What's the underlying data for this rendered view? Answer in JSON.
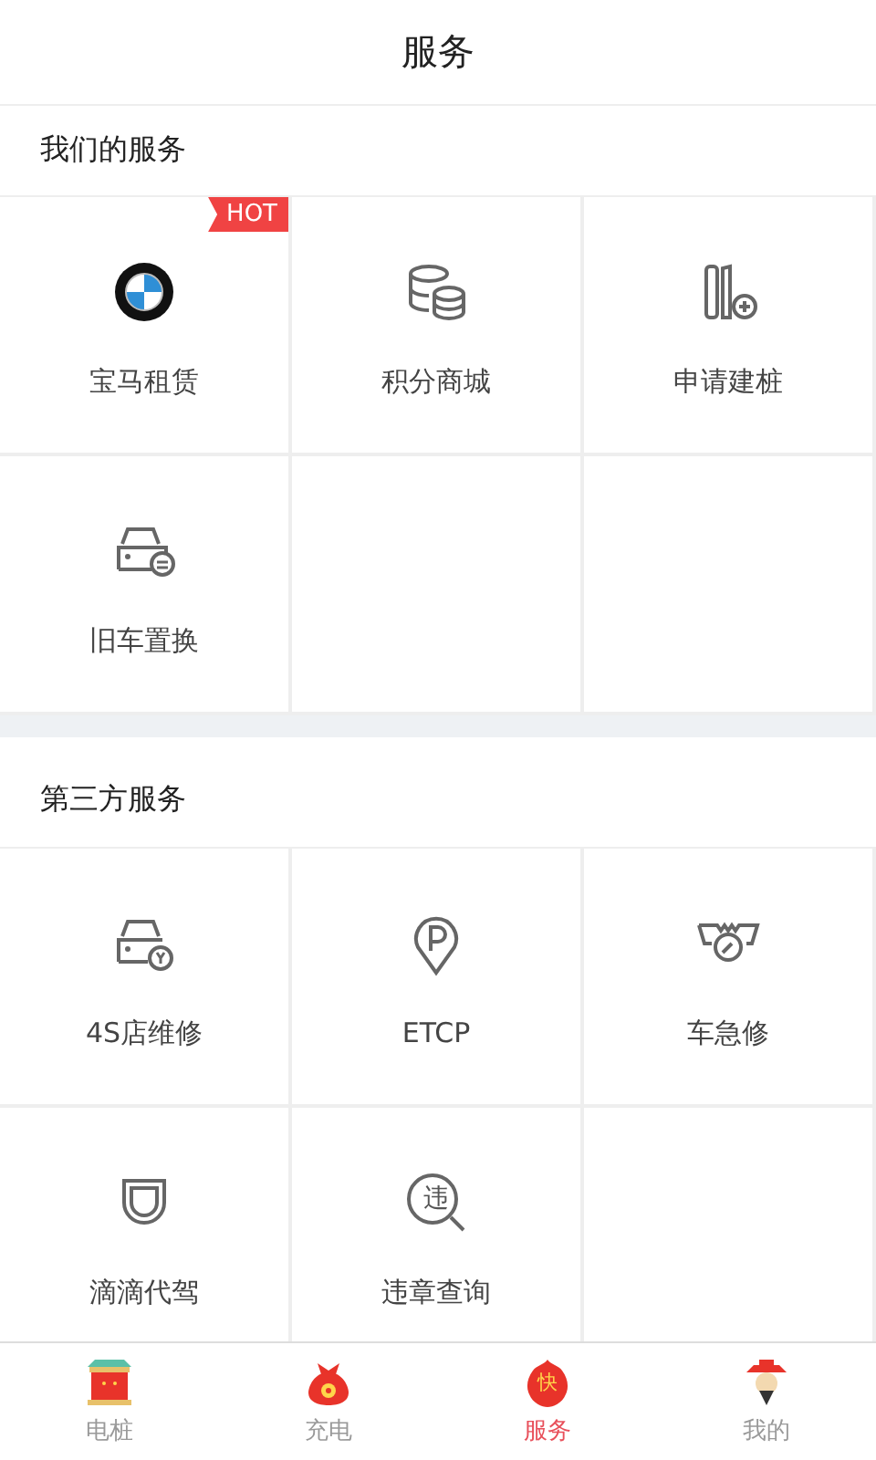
{
  "header": {
    "title": "服务"
  },
  "sections": [
    {
      "title": "我们的服务",
      "items": [
        {
          "label": "宝马租赁",
          "kind": "bmw",
          "badge": "HOT"
        },
        {
          "label": "积分商城",
          "kind": "coins"
        },
        {
          "label": "申请建桩",
          "kind": "pile"
        },
        {
          "label": "旧车置换",
          "kind": "car-swap"
        }
      ]
    },
    {
      "title": "第三方服务",
      "items": [
        {
          "label": "4S店维修",
          "kind": "car-repair"
        },
        {
          "label": "ETCP",
          "kind": "parking"
        },
        {
          "label": "车急修",
          "kind": "tow"
        },
        {
          "label": "滴滴代驾",
          "kind": "didi"
        },
        {
          "label": "违章查询",
          "kind": "violation",
          "icon_char": "违"
        }
      ]
    }
  ],
  "tabs": [
    {
      "label": "电桩",
      "kind": "gate",
      "selected": false
    },
    {
      "label": "充电",
      "kind": "bag",
      "selected": false
    },
    {
      "label": "服务",
      "kind": "flame",
      "icon_char": "快",
      "selected": true
    },
    {
      "label": "我的",
      "kind": "figure",
      "selected": false
    }
  ]
}
